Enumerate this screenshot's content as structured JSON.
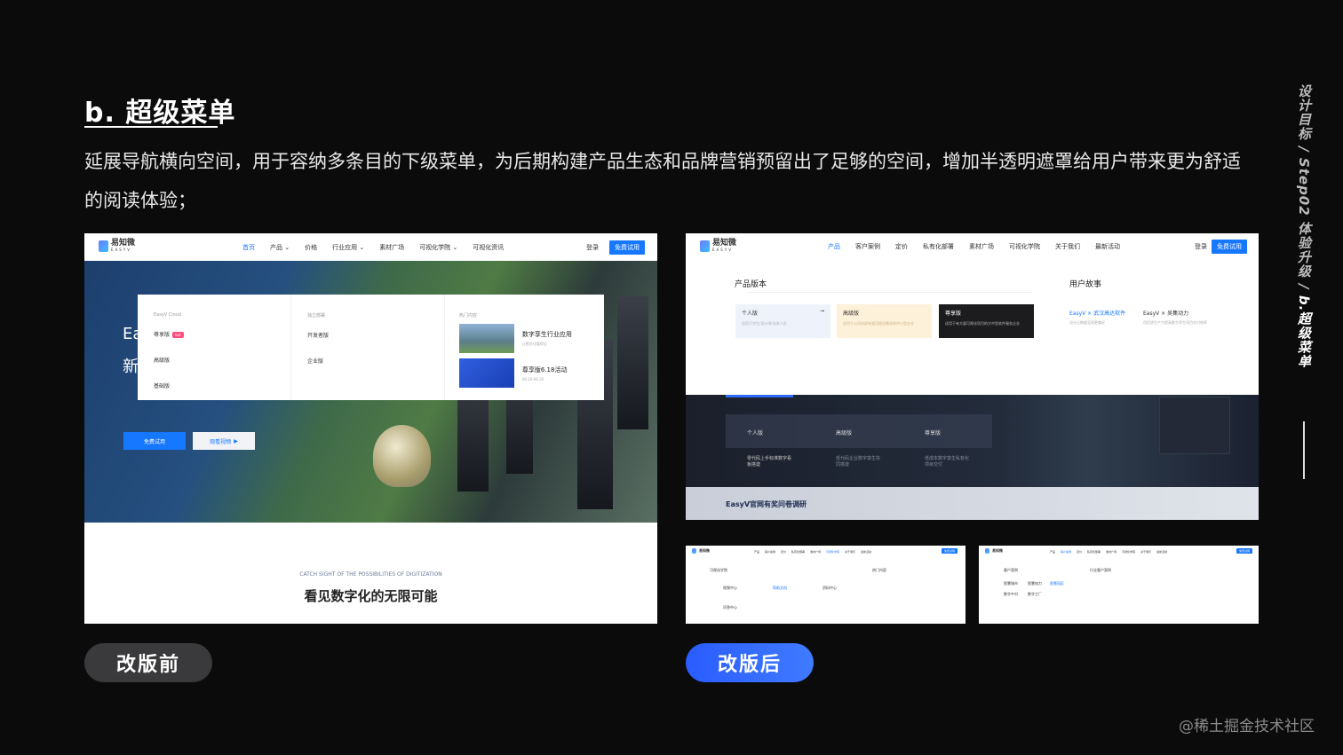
{
  "slide": {
    "title": "b. 超级菜单",
    "description": "延展导航横向空间，用于容纳多条目的下级菜单，为后期构建产品生态和品牌营销预留出了足够的空间，增加半透明遮罩给用户带来更为舒适的阅读体验；",
    "side_label_1": "设计目标 / Step02 体验升级 / ",
    "side_label_2": "b.超级菜单",
    "watermark": "@稀土掘金技术社区",
    "before_label": "改版前",
    "after_label": "改版后"
  },
  "logo": {
    "name": "易知微",
    "sub": "EASYV"
  },
  "before": {
    "nav": [
      "首页",
      "产品 ⌄",
      "价格",
      "行业应用 ⌄",
      "素材广场",
      "可视化学院 ⌄",
      "可视化资讯"
    ],
    "login": "登录",
    "trial": "免费试用",
    "menu": {
      "col1": {
        "heading": "EasyV Cloud",
        "items": [
          "尊享版",
          "高级版",
          "基础版"
        ],
        "hot": "hot"
      },
      "col2": {
        "heading": "独立部署",
        "items": [
          "开发者版",
          "企业版"
        ]
      },
      "col3": {
        "heading": "热门内容",
        "cards": [
          {
            "title": "数字孪生行业应用",
            "sub": "让数字化看得见"
          },
          {
            "title": "尊享版6.18活动",
            "sub": "06.10-06.20"
          }
        ]
      }
    },
    "hero_text": [
      "Ea",
      "新"
    ],
    "hero_buttons": {
      "trial": "免费试用",
      "video": "观看视频"
    },
    "catch": "CATCH SIGHT OF THE POSSIBILITIES OF DIGITIZATION",
    "slogan": "看见数字化的无限可能"
  },
  "after": {
    "nav": [
      "产品",
      "客户案例",
      "定价",
      "私有化部署",
      "素材广场",
      "可视化学院",
      "关于我们",
      "最新活动"
    ],
    "login": "登录",
    "trial": "免费试用",
    "versions_heading": "产品版本",
    "versions": [
      {
        "name": "个人版",
        "desc": "适用于学生/设计师/业务人员"
      },
      {
        "name": "高级版",
        "desc": "适用于公司内部有强可视化需求的中小型企业"
      },
      {
        "name": "尊享版",
        "desc": "适用于有大量可视化项目的大中型软件服务企业"
      }
    ],
    "stories_heading": "用户故事",
    "stories": [
      {
        "name": "EasyV × 武汉高达软件",
        "desc": "设计让数据呈现更美好"
      },
      {
        "name": "EasyV × 吴集动力",
        "desc": "用优质生产力提高数字孪生项目交付效率"
      }
    ],
    "dark_bar": [
      {
        "name": "个人版",
        "desc": "零代码上手标准数字看板搭建"
      },
      {
        "name": "高级版",
        "desc": "低代码企业数字孪生协同搭建"
      },
      {
        "name": "尊享版",
        "desc": "低成本数字孪生私有化项目交付"
      }
    ],
    "survey": "EasyV官网有奖问卷调研"
  },
  "thumb1": {
    "headings": [
      "可视化学院",
      "热门内容"
    ],
    "items": [
      "视频中心",
      "帮助文档",
      "资料中心",
      "问答中心"
    ]
  },
  "thumb2": {
    "headings": [
      "客户案例",
      "行业客户案例"
    ],
    "items": [
      "智慧城市",
      "智慧电力",
      "智慧园区",
      "数字乡村",
      "数字工厂"
    ]
  }
}
